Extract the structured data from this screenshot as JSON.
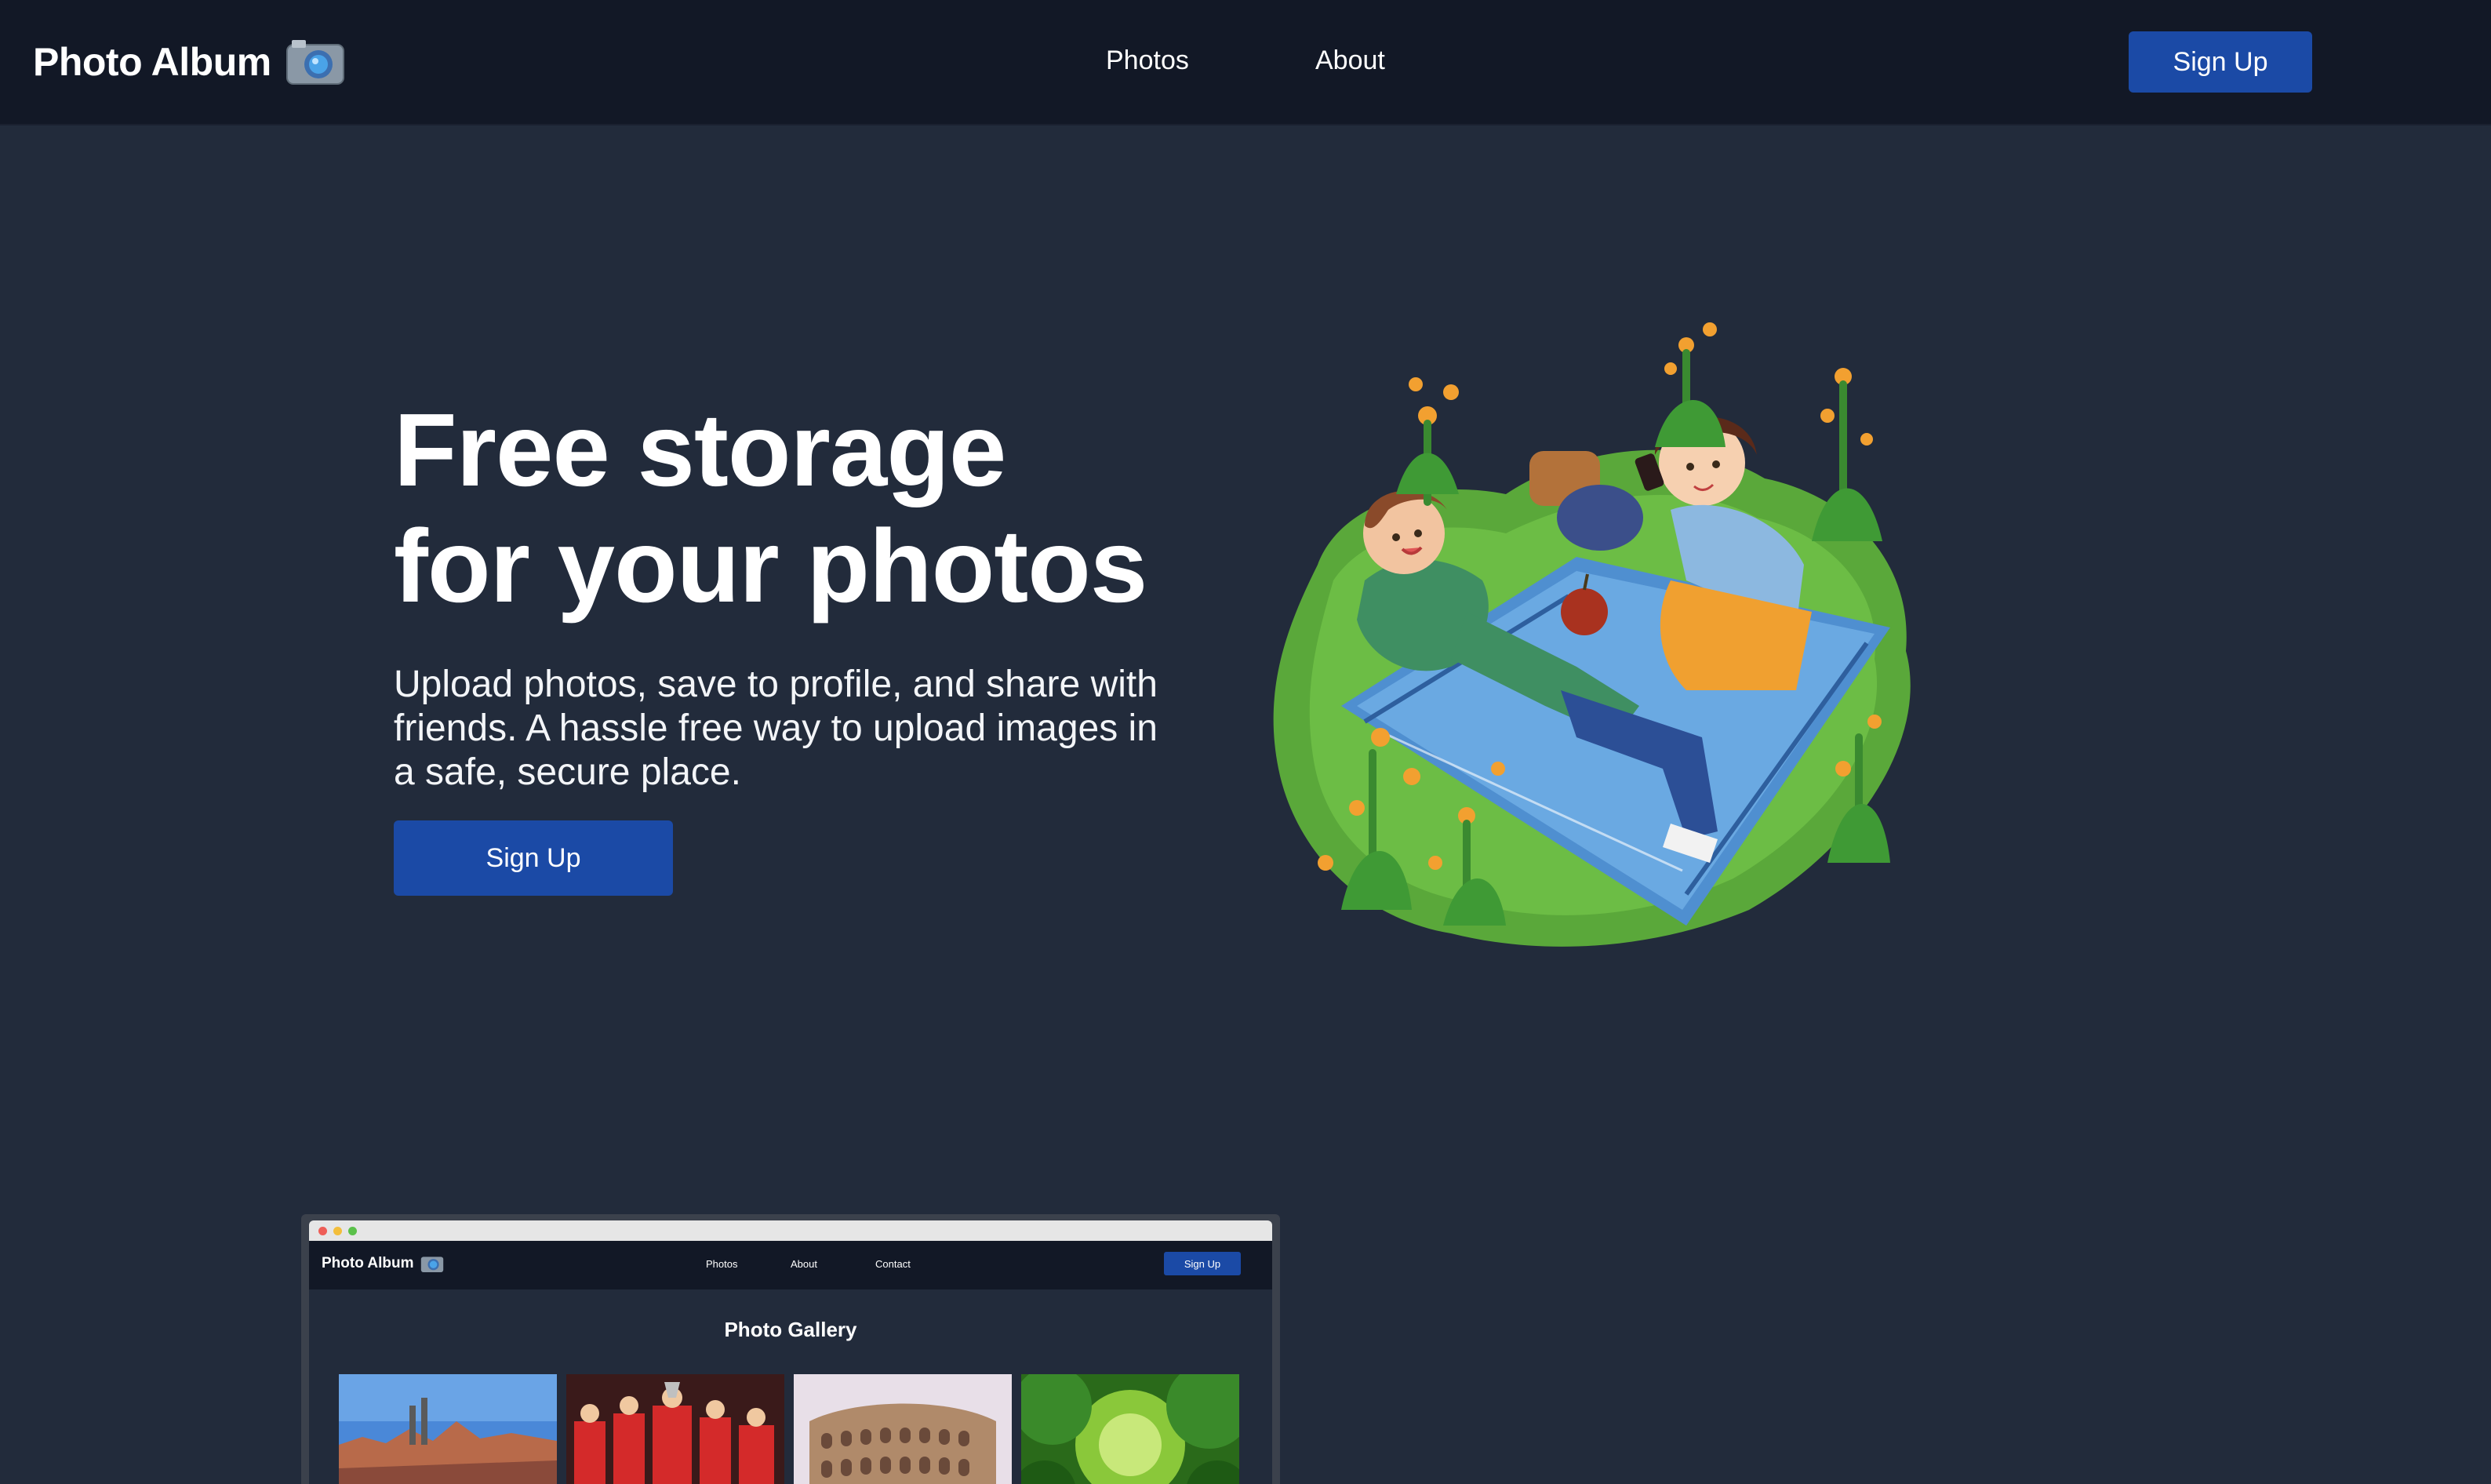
{
  "navbar": {
    "brand": "Photo Album",
    "brand_icon": "camera-icon",
    "links": [
      "Photos",
      "About"
    ],
    "signup_label": "Sign Up",
    "signup_color": "#1b4aa6"
  },
  "hero": {
    "title_line1": "Free storage",
    "title_line2": "for your photos",
    "subtitle": "Upload photos, save to profile, and share with friends. A hassle free way to upload images in a safe, secure place.",
    "signup_label": "Sign Up",
    "illustration": "picnic-illustration"
  },
  "mockup": {
    "brand": "Photo Album",
    "links": [
      "Photos",
      "About",
      "Contact"
    ],
    "signup_label": "Sign Up",
    "gallery_title": "Photo Gallery",
    "thumbnails": [
      "city-skyline-photo",
      "soccer-team-photo",
      "colosseum-photo",
      "forest-canopy-photo"
    ]
  },
  "colors": {
    "background": "#222b3b",
    "navbar": "#121826",
    "accent": "#1b4aa6"
  }
}
